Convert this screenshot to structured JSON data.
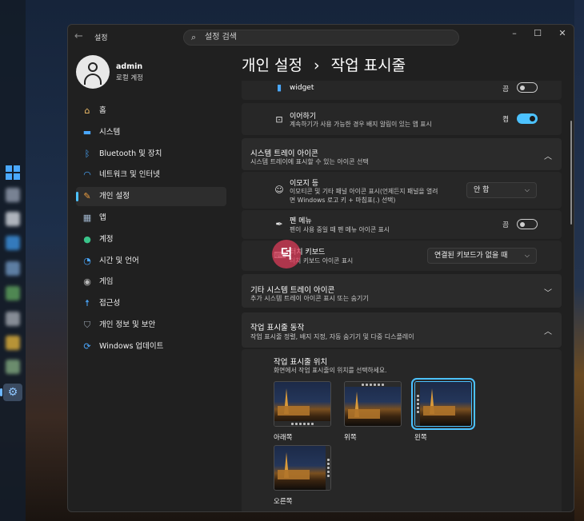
{
  "app": {
    "title": "설정",
    "search_placeholder": "설정 검색"
  },
  "user": {
    "name": "admin",
    "type": "로컬 계정"
  },
  "nav": [
    {
      "label": "홈",
      "icon": "home-icon"
    },
    {
      "label": "시스템",
      "icon": "monitor-icon"
    },
    {
      "label": "Bluetooth 및 장치",
      "icon": "bluetooth-icon"
    },
    {
      "label": "네트워크 및 인터넷",
      "icon": "wifi-icon"
    },
    {
      "label": "개인 설정",
      "icon": "brush-icon",
      "active": true
    },
    {
      "label": "앱",
      "icon": "apps-icon"
    },
    {
      "label": "계정",
      "icon": "person-icon"
    },
    {
      "label": "시간 및 언어",
      "icon": "clock-globe-icon"
    },
    {
      "label": "게임",
      "icon": "gamepad-icon"
    },
    {
      "label": "접근성",
      "icon": "accessibility-icon"
    },
    {
      "label": "개인 정보 및 보안",
      "icon": "shield-icon"
    },
    {
      "label": "Windows 업데이트",
      "icon": "update-icon"
    }
  ],
  "breadcrumb": {
    "parent": "개인 설정",
    "separator": "›",
    "current": "작업 표시줄"
  },
  "widgets_row": {
    "label": "widget",
    "state": "끔",
    "on": false
  },
  "continue_row": {
    "title": "이어하기",
    "desc": "계속하기가 사용 가능한 경우 배지 알림이 있는 앱 표시",
    "state": "켬",
    "on": true
  },
  "tray_section": {
    "title": "시스템 트레이 아이콘",
    "desc": "시스템 트레이에 표시할 수 있는 아이콘 선택",
    "emoji": {
      "title": "이모지 등",
      "desc_line1": "이모티콘 및 기타 패널 아이콘 표시(언제든지 패널을 열려",
      "desc_line2": "면 Windows 로고 키 + 마침표(.) 선택)",
      "value": "안 함"
    },
    "pen": {
      "title": "펜 메뉴",
      "desc": "펜이 사용 중일 때 펜 메뉴 아이콘 표시",
      "state": "끔",
      "on": false
    },
    "touch_keyboard": {
      "title": "터치 키보드",
      "desc": "터치 키보드 아이콘 표시",
      "value": "연결된 키보드가 없을 때"
    }
  },
  "other_tray": {
    "title": "기타 시스템 트레이 아이콘",
    "desc": "추가 시스템 트레이 아이콘 표시 또는 숨기기"
  },
  "behaviors": {
    "title": "작업 표시줄 동작",
    "desc": "작업 표시줄 정렬, 배지 지정, 자동 숨기기 및 다중 디스플레이",
    "position_title": "작업 표시줄 위치",
    "position_desc": "화면에서 작업 표시줄의 위치를 선택하세요.",
    "options": [
      {
        "label": "아래쪽",
        "selected": false
      },
      {
        "label": "위쪽",
        "selected": false
      },
      {
        "label": "왼쪽",
        "selected": true
      },
      {
        "label": "오른쪽",
        "selected": false
      }
    ]
  },
  "watermark": "덕",
  "colors": {
    "accent": "#4cc2ff",
    "window_bg": "#202020",
    "card_bg": "#2b2b2b"
  }
}
